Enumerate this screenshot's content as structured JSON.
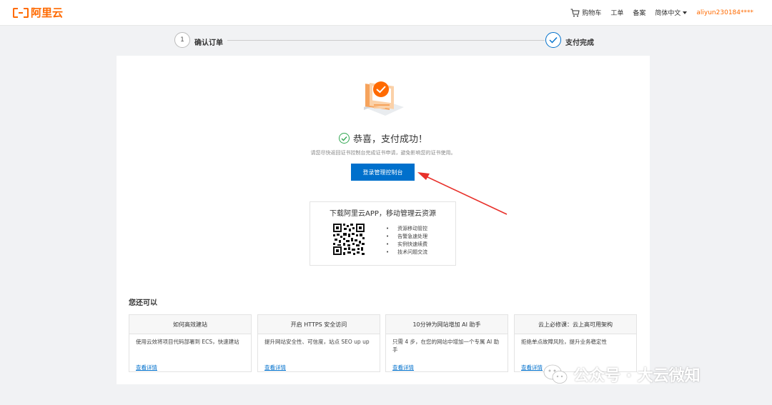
{
  "header": {
    "brand": "阿里云",
    "nav": {
      "cart": "购物车",
      "ticket": "工单",
      "filing": "备案",
      "language": "简体中文",
      "user": "aliyun230184****"
    }
  },
  "steps": [
    {
      "number": "1",
      "label": "确认订单"
    },
    {
      "label": "支付完成"
    }
  ],
  "result": {
    "title": "恭喜，支付成功！",
    "hint": "请您尽快返回证书控制台完成证书申请，避免影响您的证书使用。",
    "button": "登录管理控制台"
  },
  "app": {
    "title": "下载阿里云APP，移动管理云资源",
    "features": [
      "资源移动管控",
      "告警急速处理",
      "实例快速续费",
      "技术问题交流"
    ]
  },
  "more": {
    "title": "您还可以",
    "cards": [
      {
        "title": "如何高效建站",
        "desc": "使用云效将项目代码部署到 ECS，快速建站",
        "link": "查看详情"
      },
      {
        "title": "开启 HTTPS 安全访问",
        "desc": "提升网站安全性、可信度，站点 SEO up up",
        "link": "查看详情"
      },
      {
        "title": "10分钟为网站增加 AI 助手",
        "desc": "只需 4 步，在您的网站中增加一个专属 AI 助手",
        "link": "查看详情"
      },
      {
        "title": "云上必修课：云上高可用架构",
        "desc": "拒绝单点故障风险，提升业务稳定性",
        "link": "查看详情"
      }
    ]
  },
  "watermark": "公众号 · 大云微知",
  "colors": {
    "brand": "#ff6a00",
    "primary": "#0070cc",
    "success": "#33a853",
    "annotation_arrow": "#e8302a"
  }
}
